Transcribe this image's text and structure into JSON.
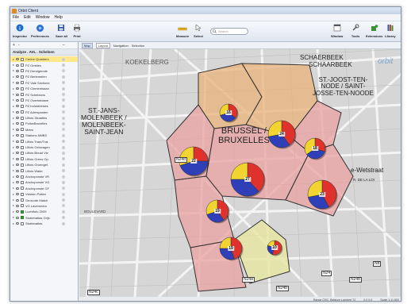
{
  "window": {
    "title": "Orbit Client"
  },
  "menu": [
    "File",
    "Edit",
    "Window",
    "Help"
  ],
  "toolbar": {
    "left": [
      {
        "label": "Inspector",
        "icon": "info-icon"
      },
      {
        "label": "Preferences",
        "icon": "preferences-icon"
      },
      {
        "label": "Save all",
        "icon": "save-icon"
      },
      {
        "label": "Print",
        "icon": "print-icon"
      }
    ],
    "center": [
      {
        "label": "Measure",
        "icon": "measure-icon"
      },
      {
        "label": "Select",
        "icon": "select-icon"
      }
    ],
    "search_placeholder": "Search",
    "right": [
      {
        "label": "Window",
        "icon": "window-icon"
      },
      {
        "label": "Tools",
        "icon": "tools-icon"
      },
      {
        "label": "Extensions",
        "icon": "extensions-icon"
      },
      {
        "label": "Library",
        "icon": "library-icon"
      }
    ]
  },
  "left_panel": {
    "toolbar": [
      "+",
      "-",
      "--"
    ],
    "title": "Analyze . AVL . Schelsen",
    "layers": [
      {
        "name": "Centre Quartiers",
        "checked": false,
        "selected": true
      },
      {
        "name": "PZ Ombles",
        "checked": false
      },
      {
        "name": "PZ Dendgemde",
        "checked": false
      },
      {
        "name": "PZ Bertemelen",
        "checked": false
      },
      {
        "name": "PZ Vale Sectione",
        "checked": false
      },
      {
        "name": "PZ Clementsaan",
        "checked": false
      },
      {
        "name": "PZ Scheldons",
        "checked": false
      },
      {
        "name": "PZ Overheldane",
        "checked": false
      },
      {
        "name": "PZ Industrieises",
        "checked": false
      },
      {
        "name": "PZ Adresposten",
        "checked": false
      },
      {
        "name": "Liflois Straathis",
        "checked": false
      },
      {
        "name": "PoliceBruxelles",
        "checked": false
      },
      {
        "name": "Metro",
        "checked": false
      },
      {
        "name": "Stations NMBS",
        "checked": false
      },
      {
        "name": "Liflois Tram/Trai.",
        "checked": false
      },
      {
        "name": "Liflois Gelovagen",
        "checked": false
      },
      {
        "name": "Liflois Bread Vie",
        "checked": false
      },
      {
        "name": "Liflois Grens Op.",
        "checked": false
      },
      {
        "name": "Liflois Groenget.",
        "checked": false
      },
      {
        "name": "Liflois Water",
        "checked": false
      },
      {
        "name": "Anchoponste VR",
        "checked": false
      },
      {
        "name": "Anchoponste VG",
        "checked": false
      },
      {
        "name": "Anchoponste GF",
        "checked": false
      },
      {
        "name": "Vlamen Patien",
        "checked": false
      },
      {
        "name": "Geocode Match",
        "checked": false
      },
      {
        "name": "VG Lavensnivo",
        "checked": false
      },
      {
        "name": "Luchtfoto 2009",
        "checked": true
      },
      {
        "name": "Stratenatlas Grijs",
        "checked": true
      },
      {
        "name": "Stratenatlas",
        "checked": false
      }
    ]
  },
  "map": {
    "toolbar": [
      "Map",
      "Layout",
      "Navigation",
      "Selection"
    ],
    "watermark": "orbit",
    "labels": [
      {
        "text": "KOEKELBERG"
      },
      {
        "text": "SCHAERBEEK"
      },
      {
        "text": "SCHAARBEEK"
      },
      {
        "text": "ST.-JOOST-TEN-\nNODE / SAINT-\nJOSSE-TEN-NOODE"
      },
      {
        "text": "ST.-JANS-\nMOLENBEEK /\nMOLENBEEK-\nSAINT-JEAN"
      },
      {
        "text": "BRUSSEL /\nBRUXELLES"
      },
      {
        "text": "e-Wetstraat"
      },
      {
        "text": "R. DE LA LOI"
      },
      {
        "text": "BOULEVARD"
      },
      {
        "text": "N24"
      },
      {
        "text": "N24a"
      },
      {
        "text": "N24b"
      },
      {
        "text": "N24c"
      },
      {
        "text": "N24d"
      },
      {
        "text": "N248"
      },
      {
        "text": "N8"
      }
    ],
    "pies": [
      {
        "value": 16,
        "slices": [
          0.35,
          0.35,
          0.3
        ]
      },
      {
        "value": 24,
        "slices": [
          0.4,
          0.32,
          0.28
        ]
      },
      {
        "value": 18,
        "slices": [
          0.3,
          0.35,
          0.35
        ]
      },
      {
        "value": 22,
        "slices": [
          0.25,
          0.45,
          0.3
        ]
      },
      {
        "value": 27,
        "slices": [
          0.38,
          0.37,
          0.25
        ]
      },
      {
        "value": 23,
        "slices": [
          0.42,
          0.3,
          0.28
        ]
      },
      {
        "value": 19,
        "slices": [
          0.4,
          0.3,
          0.3
        ]
      },
      {
        "value": 19,
        "slices": [
          0.45,
          0.3,
          0.25
        ]
      },
      {
        "value": 10,
        "slices": [
          0.55,
          0.25,
          0.2
        ]
      }
    ],
    "pie_colors": [
      "#e0322c",
      "#2f3fb8",
      "#f2d431"
    ],
    "status": [
      "Range OSC. Belgium Lambert 72",
      "0.0 0.0",
      "Scale 1:11 800"
    ]
  }
}
